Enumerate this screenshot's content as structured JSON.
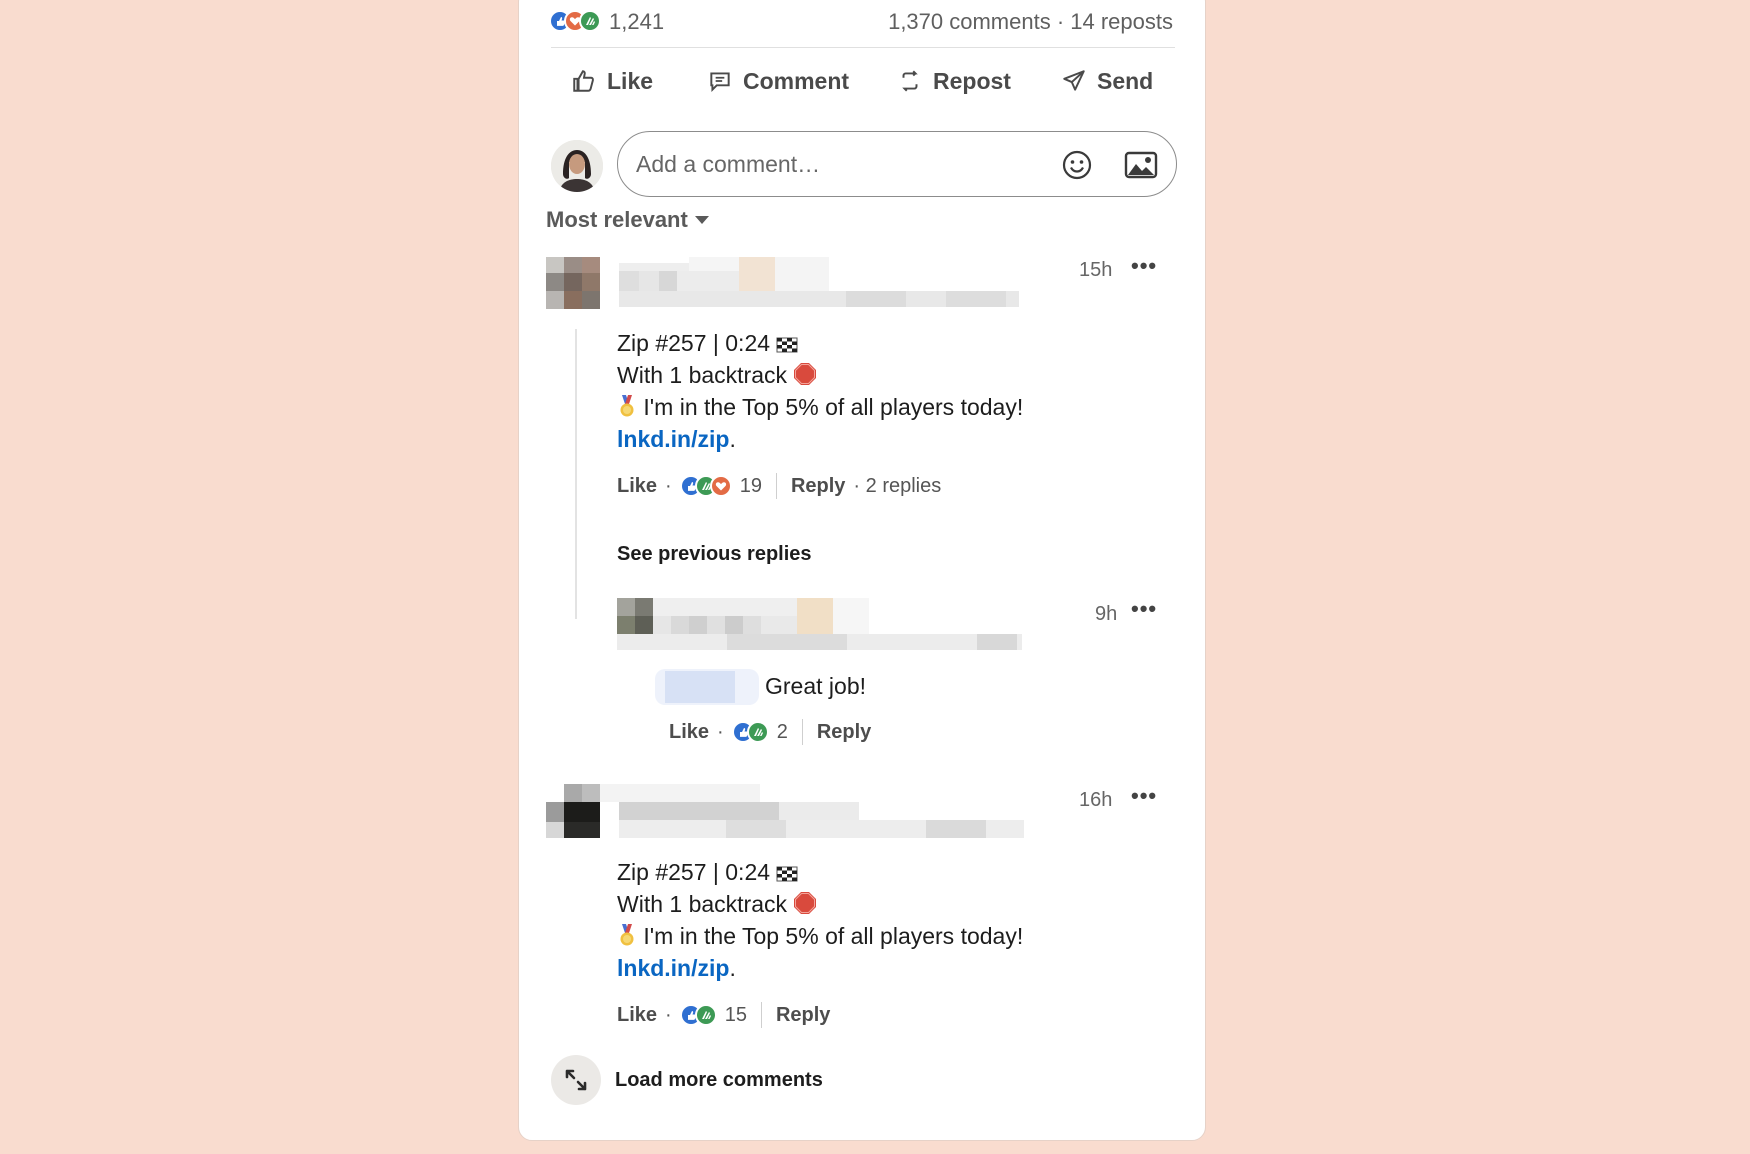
{
  "stats": {
    "reactions_count": "1,241",
    "comments_reposts": "1,370 comments · 14 reposts"
  },
  "actions": {
    "like": "Like",
    "comment": "Comment",
    "repost": "Repost",
    "send": "Send"
  },
  "composer": {
    "placeholder": "Add a comment…"
  },
  "sort": {
    "label": "Most relevant"
  },
  "comments": [
    {
      "time": "15h",
      "lines": [
        "Zip #257 | 0:24",
        "With 1 backtrack",
        "I'm in the Top 5% of all players today!"
      ],
      "link": "lnkd.in/zip",
      "link_suffix": ".",
      "like_label": "Like",
      "reaction_count": "19",
      "reply_label": "Reply",
      "replies_label": "· 2 replies"
    },
    {
      "time": "16h",
      "lines": [
        "Zip #257 | 0:24",
        "With 1 backtrack",
        "I'm in the Top 5% of all players today!"
      ],
      "link": "lnkd.in/zip",
      "link_suffix": ".",
      "like_label": "Like",
      "reaction_count": "15",
      "reply_label": "Reply"
    }
  ],
  "thread": {
    "see_previous": "See previous replies",
    "reply": {
      "time": "9h",
      "text": "Great job!",
      "like_label": "Like",
      "reaction_count": "2",
      "reply_label": "Reply"
    }
  },
  "load_more": {
    "label": "Load more comments"
  },
  "colors": {
    "background": "#f9dccf",
    "link": "#0a66c2",
    "like": "#2f6fd1",
    "love": "#e36b45",
    "celebrate": "#3d9a55"
  },
  "icons": [
    "like-icon",
    "comment-icon",
    "repost-icon",
    "send-icon",
    "emoji-icon",
    "image-icon",
    "caret-down-icon",
    "more-icon",
    "expand-icon",
    "checkered-flag-icon",
    "stop-sign-icon",
    "medal-icon"
  ]
}
